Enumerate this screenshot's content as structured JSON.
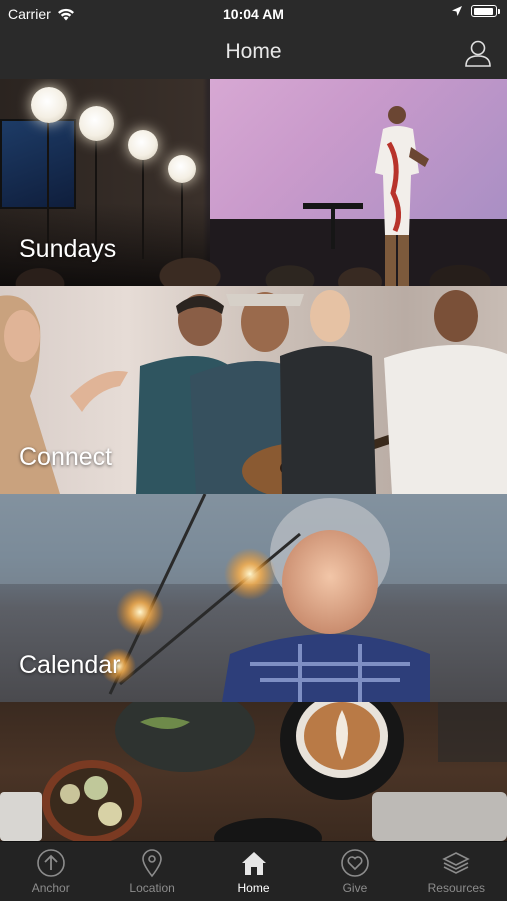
{
  "status_bar": {
    "carrier": "Carrier",
    "time": "10:04 AM",
    "battery_level": 0.95
  },
  "nav": {
    "title": "Home"
  },
  "tiles": [
    {
      "label": "Sundays"
    },
    {
      "label": "Connect"
    },
    {
      "label": "Calendar"
    },
    {
      "label": ""
    }
  ],
  "tabs": [
    {
      "label": "Anchor",
      "icon": "arrow-up-circle-icon"
    },
    {
      "label": "Location",
      "icon": "map-pin-icon"
    },
    {
      "label": "Home",
      "icon": "home-icon",
      "active": true
    },
    {
      "label": "Give",
      "icon": "heart-circle-icon"
    },
    {
      "label": "Resources",
      "icon": "layers-icon"
    }
  ],
  "colors": {
    "tab_inactive": "#8c8c8c",
    "tab_active": "#ffffff",
    "bar_bg": "#2a2a2a"
  }
}
